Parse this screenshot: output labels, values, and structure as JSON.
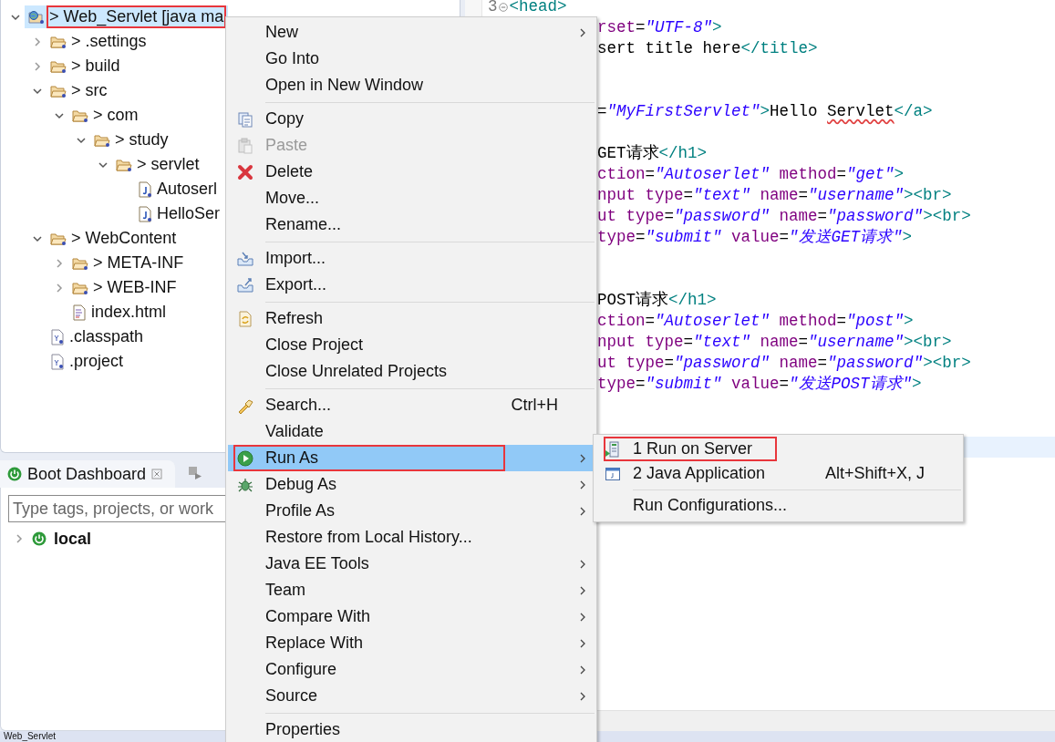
{
  "explorer": {
    "tree": [
      {
        "label": "> Web_Servlet [java ma",
        "kind": "project",
        "expanded": true,
        "selected": true,
        "annotated": true,
        "children": [
          {
            "label": "> .settings",
            "kind": "folder",
            "expanded": false,
            "selected": false,
            "annotated": false
          },
          {
            "label": "> build",
            "kind": "folder",
            "expanded": false,
            "selected": false,
            "annotated": false
          },
          {
            "label": "> src",
            "kind": "folder",
            "expanded": true,
            "selected": false,
            "annotated": false,
            "children": [
              {
                "label": "> com",
                "kind": "folder",
                "expanded": true,
                "selected": false,
                "annotated": false,
                "children": [
                  {
                    "label": "> study",
                    "kind": "folder",
                    "expanded": true,
                    "selected": false,
                    "annotated": false,
                    "children": [
                      {
                        "label": "> servlet",
                        "kind": "folder",
                        "expanded": true,
                        "selected": false,
                        "annotated": false,
                        "children": [
                          {
                            "label": "Autoserl",
                            "kind": "java",
                            "selected": false,
                            "annotated": false
                          },
                          {
                            "label": "HelloSer",
                            "kind": "java",
                            "selected": false,
                            "annotated": false
                          }
                        ]
                      }
                    ]
                  }
                ]
              }
            ]
          },
          {
            "label": "> WebContent",
            "kind": "folder",
            "expanded": true,
            "selected": false,
            "annotated": false,
            "children": [
              {
                "label": "> META-INF",
                "kind": "folder",
                "expanded": false,
                "selected": false,
                "annotated": false
              },
              {
                "label": "> WEB-INF",
                "kind": "folder",
                "expanded": false,
                "selected": false,
                "annotated": false
              },
              {
                "label": "index.html",
                "kind": "html",
                "selected": false,
                "annotated": false
              }
            ]
          },
          {
            "label": ".classpath",
            "kind": "xml",
            "selected": false,
            "annotated": false
          },
          {
            "label": ".project",
            "kind": "xml",
            "selected": false,
            "annotated": false
          }
        ]
      }
    ]
  },
  "boot_dashboard": {
    "tab": {
      "label": "Boot Dashboard"
    },
    "search": {
      "placeholder": "Type tags, projects, or work"
    },
    "items": [
      {
        "label": "local",
        "expanded": false
      }
    ]
  },
  "editor": {
    "lines": [
      {
        "kind": "numbered",
        "number": "3",
        "tokens": [
          {
            "kind": "tag",
            "text": "<head>"
          }
        ]
      },
      {
        "kind": "code",
        "tokens": [
          {
            "kind": "attr",
            "text": "rset"
          },
          {
            "kind": "text",
            "text": "="
          },
          {
            "kind": "string",
            "text": "\"UTF-8\""
          },
          {
            "kind": "tag",
            "text": ">"
          }
        ]
      },
      {
        "kind": "code",
        "tokens": [
          {
            "kind": "text",
            "text": "sert title here"
          },
          {
            "kind": "tag",
            "text": "</title>"
          }
        ]
      },
      {
        "kind": "blank"
      },
      {
        "kind": "blank"
      },
      {
        "kind": "code",
        "tokens": [
          {
            "kind": "text",
            "text": "="
          },
          {
            "kind": "string",
            "text": "\"MyFirstServlet\""
          },
          {
            "kind": "tag",
            "text": ">"
          },
          {
            "kind": "text",
            "text": "Hello "
          },
          {
            "kind": "typo",
            "text": "Servlet"
          },
          {
            "kind": "tag",
            "text": "</a>"
          }
        ]
      },
      {
        "kind": "blank"
      },
      {
        "kind": "code",
        "tokens": [
          {
            "kind": "text",
            "text": "GET请求"
          },
          {
            "kind": "tag",
            "text": "</h1>"
          }
        ]
      },
      {
        "kind": "code",
        "tokens": [
          {
            "kind": "attr",
            "text": "ction"
          },
          {
            "kind": "text",
            "text": "="
          },
          {
            "kind": "string",
            "text": "\"Autoserlet\""
          },
          {
            "kind": "attr",
            "text": " method"
          },
          {
            "kind": "text",
            "text": "="
          },
          {
            "kind": "string",
            "text": "\"get\""
          },
          {
            "kind": "tag",
            "text": ">"
          }
        ]
      },
      {
        "kind": "code",
        "tokens": [
          {
            "kind": "attr",
            "text": "nput type"
          },
          {
            "kind": "text",
            "text": "="
          },
          {
            "kind": "string",
            "text": "\"text\""
          },
          {
            "kind": "attr",
            "text": " name"
          },
          {
            "kind": "text",
            "text": "="
          },
          {
            "kind": "string",
            "text": "\"username\""
          },
          {
            "kind": "tag",
            "text": "><br>"
          }
        ]
      },
      {
        "kind": "code",
        "tokens": [
          {
            "kind": "attr",
            "text": "ut type"
          },
          {
            "kind": "text",
            "text": "="
          },
          {
            "kind": "string",
            "text": "\"password\""
          },
          {
            "kind": "attr",
            "text": " name"
          },
          {
            "kind": "text",
            "text": "="
          },
          {
            "kind": "string",
            "text": "\"password\""
          },
          {
            "kind": "tag",
            "text": "><br>"
          }
        ]
      },
      {
        "kind": "code",
        "tokens": [
          {
            "kind": "attr",
            "text": "type"
          },
          {
            "kind": "text",
            "text": "="
          },
          {
            "kind": "string",
            "text": "\"submit\""
          },
          {
            "kind": "attr",
            "text": " value"
          },
          {
            "kind": "text",
            "text": "="
          },
          {
            "kind": "string",
            "text": "\"发送GET请求\""
          },
          {
            "kind": "tag",
            "text": ">"
          }
        ]
      },
      {
        "kind": "blank"
      },
      {
        "kind": "blank"
      },
      {
        "kind": "code",
        "tokens": [
          {
            "kind": "text",
            "text": "POST请求"
          },
          {
            "kind": "tag",
            "text": "</h1>"
          }
        ]
      },
      {
        "kind": "code",
        "tokens": [
          {
            "kind": "attr",
            "text": "ction"
          },
          {
            "kind": "text",
            "text": "="
          },
          {
            "kind": "string",
            "text": "\"Autoserlet\""
          },
          {
            "kind": "attr",
            "text": " method"
          },
          {
            "kind": "text",
            "text": "="
          },
          {
            "kind": "string",
            "text": "\"post\""
          },
          {
            "kind": "tag",
            "text": ">"
          }
        ]
      },
      {
        "kind": "code",
        "tokens": [
          {
            "kind": "attr",
            "text": "nput type"
          },
          {
            "kind": "text",
            "text": "="
          },
          {
            "kind": "string",
            "text": "\"text\""
          },
          {
            "kind": "attr",
            "text": " name"
          },
          {
            "kind": "text",
            "text": "="
          },
          {
            "kind": "string",
            "text": "\"username\""
          },
          {
            "kind": "tag",
            "text": "><br>"
          }
        ]
      },
      {
        "kind": "code",
        "tokens": [
          {
            "kind": "attr",
            "text": "ut type"
          },
          {
            "kind": "text",
            "text": "="
          },
          {
            "kind": "string",
            "text": "\"password\""
          },
          {
            "kind": "attr",
            "text": " name"
          },
          {
            "kind": "text",
            "text": "="
          },
          {
            "kind": "string",
            "text": "\"password\""
          },
          {
            "kind": "tag",
            "text": "><br>"
          }
        ]
      },
      {
        "kind": "code",
        "tokens": [
          {
            "kind": "attr",
            "text": "type"
          },
          {
            "kind": "text",
            "text": "="
          },
          {
            "kind": "string",
            "text": "\"submit\""
          },
          {
            "kind": "attr",
            "text": " value"
          },
          {
            "kind": "text",
            "text": "="
          },
          {
            "kind": "string",
            "text": "\"发送POST请求\""
          },
          {
            "kind": "tag",
            "text": ">"
          }
        ]
      },
      {
        "kind": "blank"
      },
      {
        "kind": "blank"
      },
      {
        "kind": "current"
      }
    ]
  },
  "context_menu": {
    "groups": [
      [
        {
          "label": "New",
          "submenu": true,
          "disabled": false,
          "selected": false,
          "annotated": false
        },
        {
          "label": "Go Into",
          "submenu": false,
          "disabled": false,
          "selected": false,
          "annotated": false
        },
        {
          "label": "Open in New Window",
          "submenu": false,
          "disabled": false,
          "selected": false,
          "annotated": false
        }
      ],
      [
        {
          "label": "Copy",
          "submenu": false,
          "disabled": false,
          "selected": false,
          "annotated": false
        },
        {
          "label": "Paste",
          "submenu": false,
          "disabled": true,
          "selected": false,
          "annotated": false
        },
        {
          "label": "Delete",
          "submenu": false,
          "disabled": false,
          "selected": false,
          "annotated": false
        },
        {
          "label": "Move...",
          "submenu": false,
          "disabled": false,
          "selected": false,
          "annotated": false
        },
        {
          "label": "Rename...",
          "submenu": false,
          "disabled": false,
          "selected": false,
          "annotated": false
        }
      ],
      [
        {
          "label": "Import...",
          "submenu": false,
          "disabled": false,
          "selected": false,
          "annotated": false
        },
        {
          "label": "Export...",
          "submenu": false,
          "disabled": false,
          "selected": false,
          "annotated": false
        }
      ],
      [
        {
          "label": "Refresh",
          "submenu": false,
          "disabled": false,
          "selected": false,
          "annotated": false
        },
        {
          "label": "Close Project",
          "submenu": false,
          "disabled": false,
          "selected": false,
          "annotated": false
        },
        {
          "label": "Close Unrelated Projects",
          "submenu": false,
          "disabled": false,
          "selected": false,
          "annotated": false
        }
      ],
      [
        {
          "label": "Search...",
          "shortcut": "Ctrl+H",
          "submenu": false,
          "disabled": false,
          "selected": false,
          "annotated": false
        },
        {
          "label": "Validate",
          "submenu": false,
          "disabled": false,
          "selected": false,
          "annotated": false
        },
        {
          "label": "Run As",
          "submenu": true,
          "disabled": false,
          "selected": true,
          "annotated": true
        },
        {
          "label": "Debug As",
          "submenu": true,
          "disabled": false,
          "selected": false,
          "annotated": false
        },
        {
          "label": "Profile As",
          "submenu": true,
          "disabled": false,
          "selected": false,
          "annotated": false
        },
        {
          "label": "Restore from Local History...",
          "submenu": false,
          "disabled": false,
          "selected": false,
          "annotated": false
        },
        {
          "label": "Java EE Tools",
          "submenu": true,
          "disabled": false,
          "selected": false,
          "annotated": false
        },
        {
          "label": "Team",
          "submenu": true,
          "disabled": false,
          "selected": false,
          "annotated": false
        },
        {
          "label": "Compare With",
          "submenu": true,
          "disabled": false,
          "selected": false,
          "annotated": false
        },
        {
          "label": "Replace With",
          "submenu": true,
          "disabled": false,
          "selected": false,
          "annotated": false
        },
        {
          "label": "Configure",
          "submenu": true,
          "disabled": false,
          "selected": false,
          "annotated": false
        },
        {
          "label": "Source",
          "submenu": true,
          "disabled": false,
          "selected": false,
          "annotated": false
        }
      ],
      [
        {
          "label": "Properties",
          "submenu": false,
          "disabled": false,
          "selected": false,
          "annotated": false
        }
      ]
    ]
  },
  "submenu": {
    "groups": [
      [
        {
          "label": "1 Run on Server",
          "submenu": false,
          "disabled": false,
          "selected": false,
          "annotated": true
        },
        {
          "label": "2 Java Application",
          "shortcut": "Alt+Shift+X, J",
          "submenu": false,
          "disabled": false,
          "selected": false,
          "annotated": false
        }
      ],
      [
        {
          "label": "Run Configurations...",
          "submenu": false,
          "disabled": false,
          "selected": false,
          "annotated": false
        }
      ]
    ]
  },
  "status_bar": {
    "text": "Web_Servlet"
  }
}
